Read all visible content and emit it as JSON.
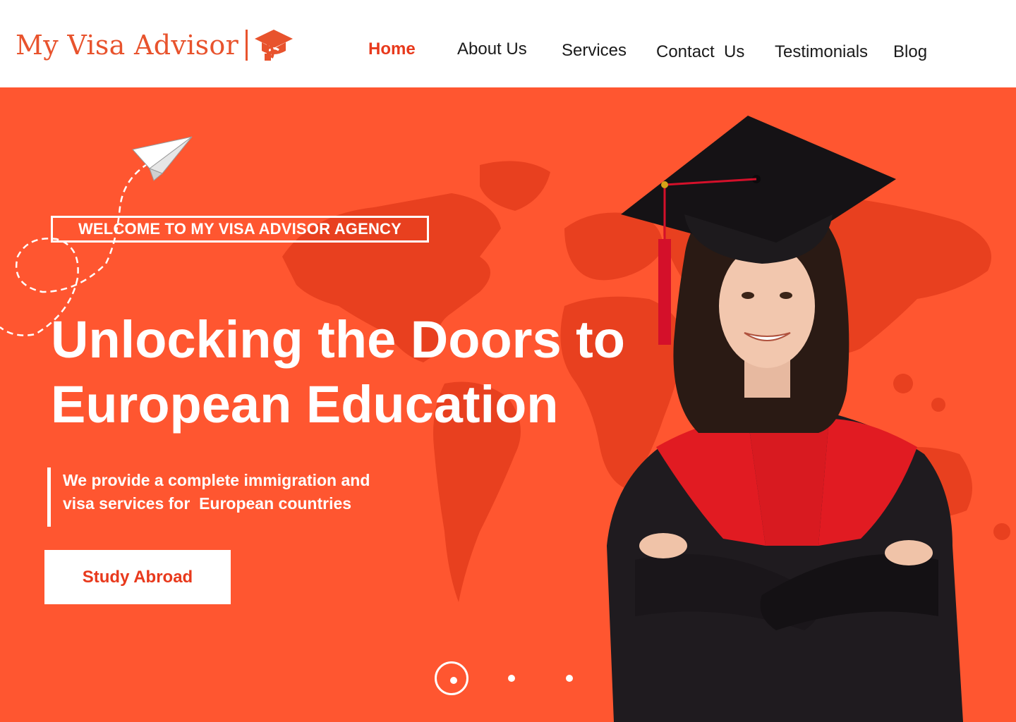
{
  "brand": {
    "name": "My Visa Advisor",
    "icon": "graduation-cap-icon",
    "color": "#e8532d"
  },
  "nav": {
    "items": [
      {
        "label": "Home",
        "active": true
      },
      {
        "label": "About Us",
        "active": false
      },
      {
        "label": "Services",
        "active": false
      },
      {
        "label": "Contact  Us",
        "active": false
      },
      {
        "label": "Testimonials",
        "active": false
      },
      {
        "label": "Blog",
        "active": false
      }
    ],
    "active_color": "#e8391c"
  },
  "hero": {
    "background_color": "#ff5630",
    "welcome": "WELCOME TO MY VISA ADVISOR AGENCY",
    "headline_line1": "Unlocking the Doors to",
    "headline_line2": "European Education",
    "description_line1": "We provide a complete immigration and",
    "description_line2": "visa services for  European countries",
    "cta_label": "Study Abroad",
    "decorations": [
      "paper-plane-icon",
      "world-map",
      "graduate-student-photo"
    ]
  },
  "carousel": {
    "slide_count": 3,
    "active_index": 0
  }
}
